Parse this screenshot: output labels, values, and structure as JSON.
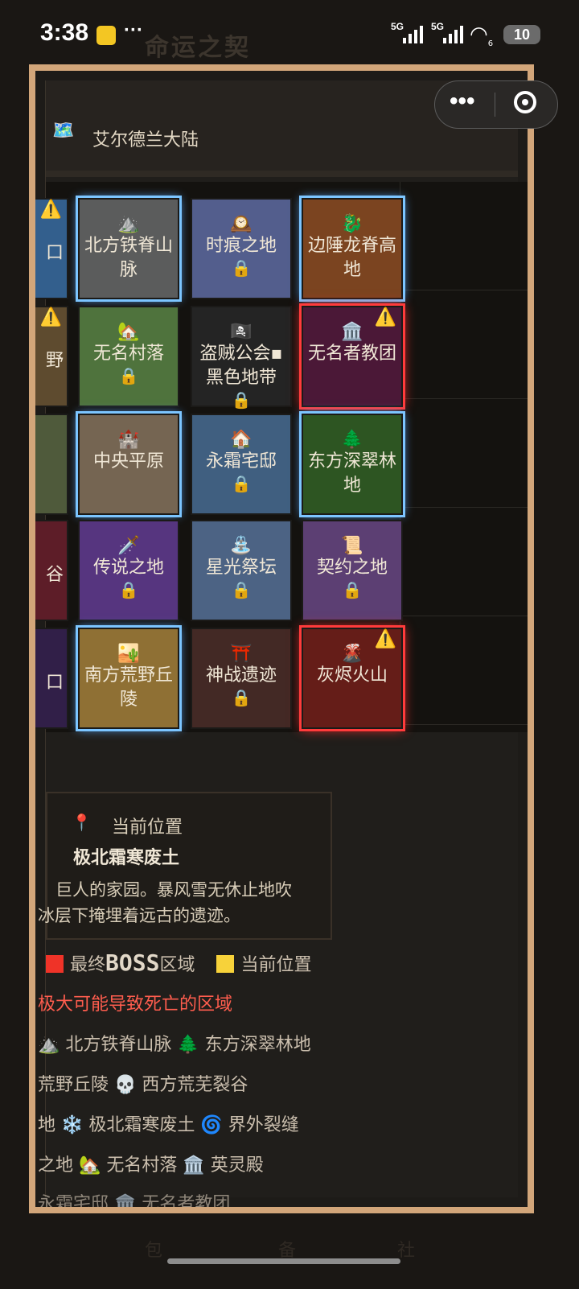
{
  "status": {
    "time": "3:38",
    "signal1": "5G",
    "signal2": "5G",
    "wifi_suffix": "6",
    "battery": "10",
    "background_title": "命运之契"
  },
  "header": {
    "title": "艾尔德兰大陆",
    "map_icon": "🗺️"
  },
  "grid": {
    "rows": [
      [
        {
          "name": "山口",
          "partial": "口",
          "icon": "",
          "locked": false,
          "warn": true,
          "border": "none",
          "color": "#335f8d"
        },
        {
          "name": "北方铁脊山脉",
          "icon": "⛰️",
          "locked": false,
          "warn": false,
          "border": "blue",
          "color": "#5b5c5c"
        },
        {
          "name": "时痕之地",
          "icon": "🕰️",
          "locked": true,
          "warn": false,
          "border": "none",
          "color": "#535e8d"
        },
        {
          "name": "边陲龙脊高地",
          "icon": "🐉",
          "locked": false,
          "warn": false,
          "border": "blue",
          "color": "#7b4420"
        }
      ],
      [
        {
          "name": "荒野",
          "partial": "野",
          "icon": "",
          "locked": false,
          "warn": true,
          "border": "none",
          "color": "#5e4b2f"
        },
        {
          "name": "无名村落",
          "icon": "🏡",
          "locked": true,
          "warn": false,
          "border": "none",
          "color": "#4f733d"
        },
        {
          "name": "盗贼公会▪黑色地带",
          "icon": "🏴‍☠️",
          "locked": true,
          "warn": false,
          "border": "none",
          "color": "#242424"
        },
        {
          "name": "无名者教团",
          "icon": "🏛️",
          "locked": false,
          "warn": true,
          "border": "red",
          "color": "#4b1837"
        }
      ],
      [
        {
          "name": "",
          "partial": "",
          "icon": "",
          "locked": false,
          "warn": false,
          "border": "none",
          "color": "#4f5a3b"
        },
        {
          "name": "中央平原",
          "icon": "🏰",
          "locked": false,
          "warn": false,
          "border": "blue",
          "color": "#756552"
        },
        {
          "name": "永霜宅邸",
          "icon": "🏠",
          "locked": true,
          "warn": false,
          "border": "none",
          "color": "#405f80"
        },
        {
          "name": "东方深翠林地",
          "icon": "🌲",
          "locked": false,
          "warn": false,
          "border": "blue",
          "color": "#2d5522"
        }
      ],
      [
        {
          "name": "裂谷",
          "partial": "谷",
          "icon": "",
          "locked": false,
          "warn": false,
          "border": "none",
          "color": "#5d1d28"
        },
        {
          "name": "传说之地",
          "icon": "🗡️",
          "locked": true,
          "warn": false,
          "border": "none",
          "color": "#56357f"
        },
        {
          "name": "星光祭坛",
          "icon": "⛲",
          "locked": true,
          "warn": false,
          "border": "none",
          "color": "#4c6384"
        },
        {
          "name": "契约之地",
          "icon": "📜",
          "locked": true,
          "warn": false,
          "border": "none",
          "color": "#5c3f73"
        }
      ],
      [
        {
          "name": "入口",
          "partial": "口",
          "icon": "",
          "locked": false,
          "warn": false,
          "border": "none",
          "color": "#311f48"
        },
        {
          "name": "南方荒野丘陵",
          "icon": "🏜️",
          "locked": false,
          "warn": false,
          "border": "blue",
          "color": "#8f7034"
        },
        {
          "name": "神战遗迹",
          "icon": "⛩️",
          "locked": true,
          "warn": false,
          "border": "none",
          "color": "#432925"
        },
        {
          "name": "灰烬火山",
          "icon": "🌋",
          "locked": false,
          "warn": true,
          "border": "red",
          "color": "#651d18"
        }
      ]
    ]
  },
  "current_location": {
    "label": "当前位置",
    "name": "极北霜寒废土",
    "description_line1": "巨人的家园。暴风雪无休止地吹",
    "description_line2": "冰层下掩埋着远古的遗迹。"
  },
  "legend": {
    "boss_prefix": "最终",
    "boss_word": "BOSS",
    "boss_suffix": "区域",
    "current": "当前位置",
    "danger": "极大可能导致死亡的区域",
    "line1": "⛰️ 北方铁脊山脉  🌲 东方深翠林地",
    "line2": "荒野丘陵  💀 西方荒芜裂谷",
    "line3": "地  ❄️ 极北霜寒废土  🌀 界外裂缝",
    "line4": "之地  🏡 无名村落  🏛️ 英灵殿",
    "line5": "永霜宅邸  🏛️ 无名者教团"
  },
  "colors": {
    "boss": "#ef3328",
    "current": "#f7d23a",
    "danger_text": "#ff5d4e"
  }
}
